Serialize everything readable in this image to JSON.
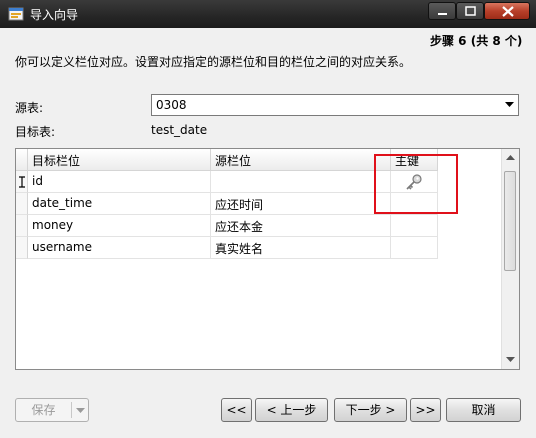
{
  "window": {
    "title": "导入向导"
  },
  "step_label": "步骤 6 (共 8 个)",
  "description": "你可以定义栏位对应。设置对应指定的源栏位和目的栏位之间的对应关系。",
  "source_table": {
    "label": "源表:",
    "value": "0308"
  },
  "target_table": {
    "label": "目标表:",
    "value": "test_date"
  },
  "grid": {
    "columns": [
      "目标栏位",
      "源栏位",
      "主键"
    ],
    "rows": [
      {
        "target": "id",
        "source": "",
        "primary_key": true
      },
      {
        "target": "date_time",
        "source": "应还时间",
        "primary_key": false
      },
      {
        "target": "money",
        "source": "应还本金",
        "primary_key": false
      },
      {
        "target": "username",
        "source": "真实姓名",
        "primary_key": false
      }
    ]
  },
  "buttons": {
    "save": "保存",
    "first": "<<",
    "prev": "< 上一步",
    "next": "下一步 >",
    "last": ">>",
    "cancel": "取消"
  },
  "icons": {
    "primary_key": "key-icon",
    "app": "import-wizard-icon"
  },
  "colors": {
    "highlight": "#e0101a",
    "titlebar": "#262626"
  }
}
